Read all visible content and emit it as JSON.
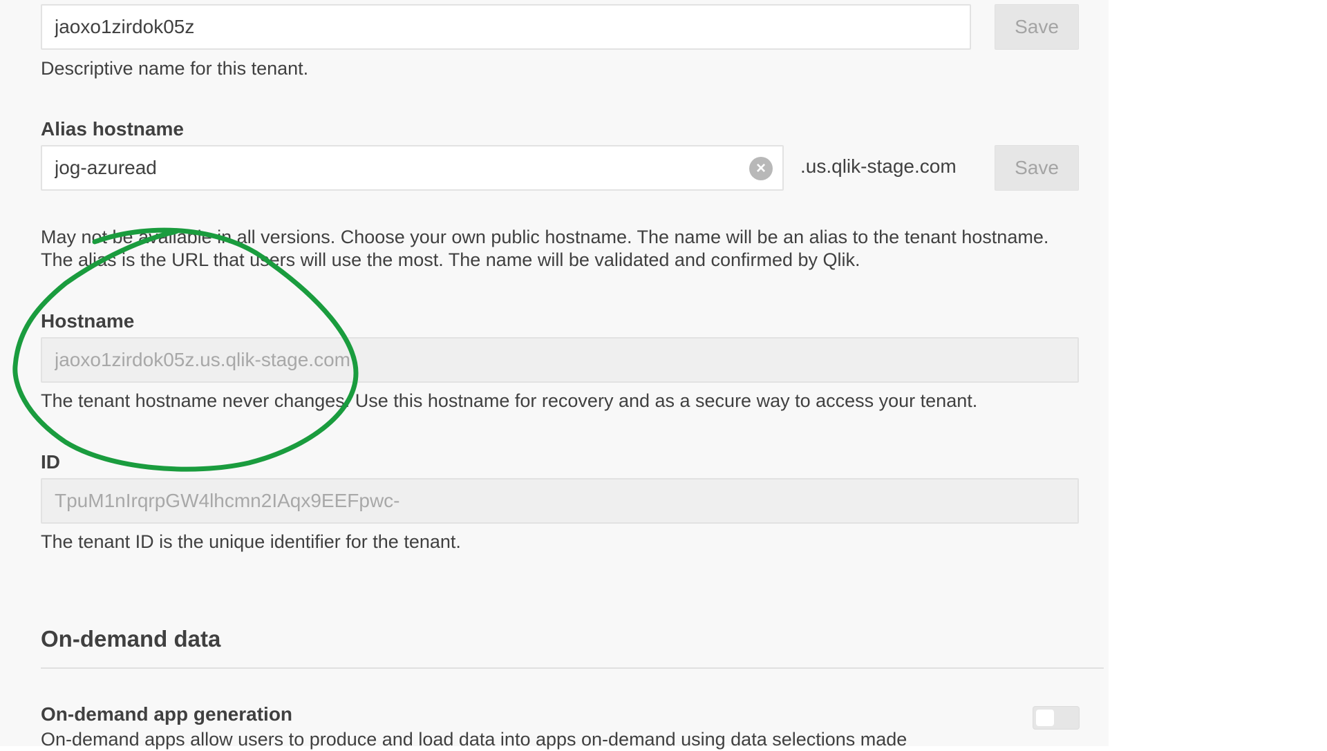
{
  "tenant_name": {
    "value": "jaoxo1zirdok05z",
    "save_label": "Save",
    "help": "Descriptive name for this tenant."
  },
  "alias": {
    "label": "Alias hostname",
    "value": "jog-azuread",
    "suffix": ".us.qlik-stage.com",
    "save_label": "Save",
    "help_line1": "May not be available in all versions. Choose your own public hostname. The name will be an alias to the tenant hostname.",
    "help_line2": "The alias is the URL that users will use the most. The name will be validated and confirmed by Qlik."
  },
  "hostname": {
    "label": "Hostname",
    "value": "jaoxo1zirdok05z.us.qlik-stage.com",
    "help": "The tenant hostname never changes. Use this hostname for recovery and as a secure way to access your tenant."
  },
  "tenant_id": {
    "label": "ID",
    "value": "TpuM1nIrqrpGW4lhcmn2IAqx9EEFpwc-",
    "help": "The tenant ID is the unique identifier for the tenant."
  },
  "on_demand": {
    "heading": "On-demand data",
    "setting_label": "On-demand app generation",
    "setting_help": "On-demand apps allow users to produce and load data into apps on-demand using data selections made",
    "enabled": false
  },
  "colors": {
    "annotation": "#1a9c3e",
    "panel": "#f8f8f8"
  }
}
